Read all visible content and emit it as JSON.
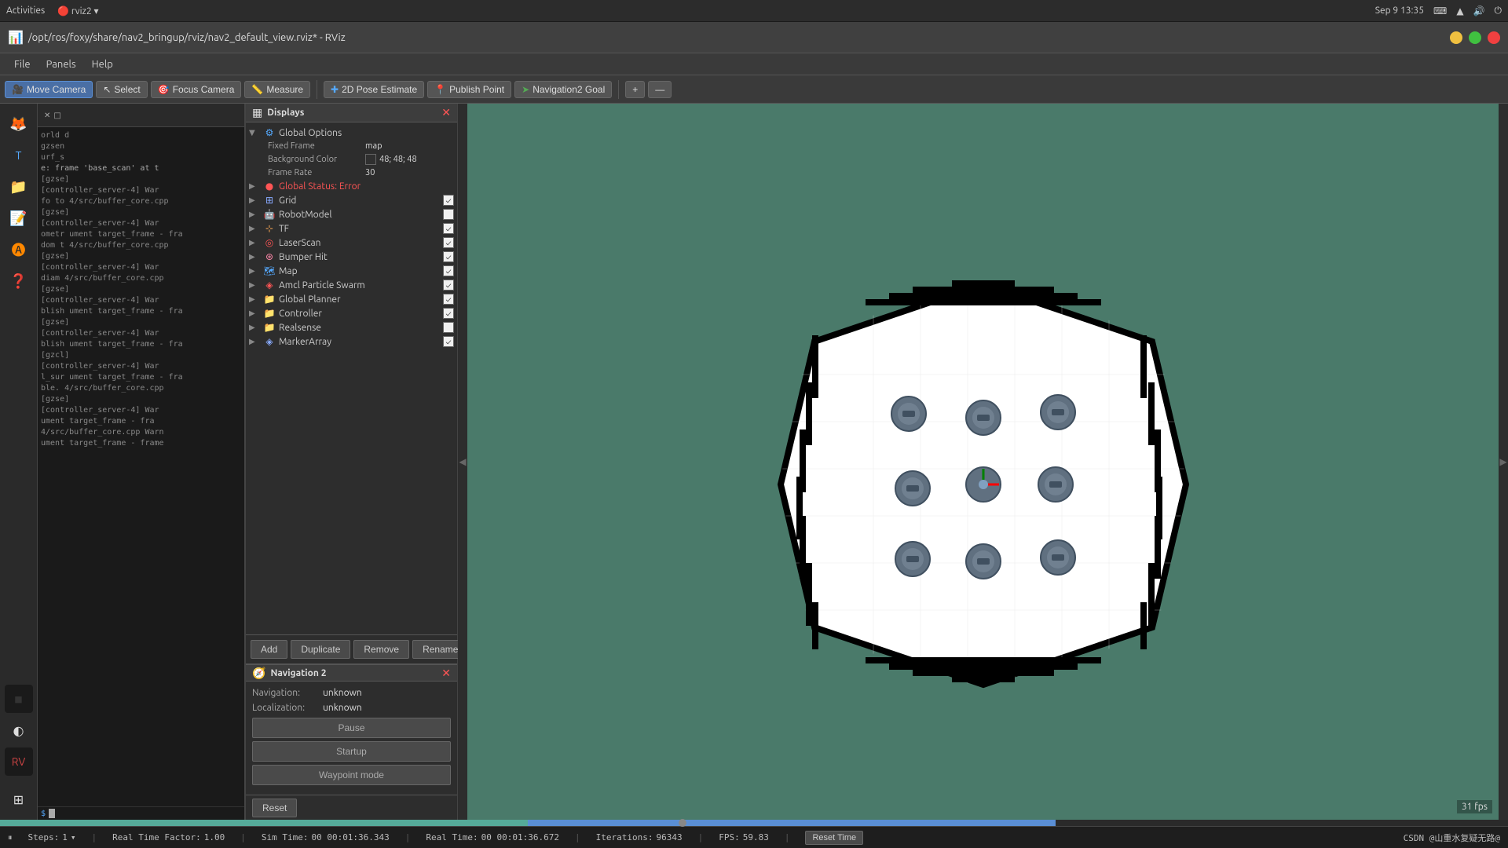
{
  "ubuntu": {
    "topbar": {
      "left_items": [
        "Activities"
      ],
      "app_name": "rviz2",
      "datetime": "Sep 9  13:35",
      "right_icons": [
        "keyboard",
        "wifi",
        "volume",
        "power"
      ]
    }
  },
  "window": {
    "title": "/opt/ros/foxy/share/nav2_bringup/rviz/nav2_default_view.rviz* - RViz",
    "close_btn": "✕",
    "max_btn": "□",
    "min_btn": "─"
  },
  "menu": {
    "items": [
      "File",
      "Panels",
      "Help"
    ]
  },
  "toolbar": {
    "move_camera_label": "Move Camera",
    "select_label": "Select",
    "focus_camera_label": "Focus Camera",
    "measure_label": "Measure",
    "pose_estimate_label": "2D Pose Estimate",
    "publish_point_label": "Publish Point",
    "nav2_goal_label": "Navigation2 Goal"
  },
  "displays": {
    "panel_title": "Displays",
    "global_options_label": "Global Options",
    "fixed_frame_key": "Fixed Frame",
    "fixed_frame_val": "map",
    "background_color_key": "Background Color",
    "background_color_val": "48; 48; 48",
    "frame_rate_key": "Frame Rate",
    "frame_rate_val": "30",
    "global_status_label": "Global Status: Error",
    "grid_label": "Grid",
    "robot_model_label": "RobotModel",
    "tf_label": "TF",
    "laser_scan_label": "LaserScan",
    "bumper_hit_label": "Bumper Hit",
    "map_label": "Map",
    "amcl_particle_label": "Amcl Particle Swarm",
    "global_planner_label": "Global Planner",
    "controller_label": "Controller",
    "realsense_label": "Realsense",
    "marker_array_label": "MarkerArray",
    "add_btn": "Add",
    "duplicate_btn": "Duplicate",
    "remove_btn": "Remove",
    "rename_btn": "Rename"
  },
  "nav2_panel": {
    "title": "Navigation 2",
    "navigation_key": "Navigation:",
    "navigation_val": "unknown",
    "localization_key": "Localization:",
    "localization_val": "unknown",
    "pause_btn": "Pause",
    "startup_btn": "Startup",
    "waypoint_btn": "Waypoint mode"
  },
  "bottom": {
    "reset_btn": "Reset",
    "fps": "31 fps"
  },
  "statusbar": {
    "pause_icon": "⏸",
    "steps_label": "Steps:",
    "steps_val": "1",
    "realtime_factor_label": "Real Time Factor:",
    "realtime_factor_val": "1.00",
    "sim_time_label": "Sim Time:",
    "sim_time_val": "00 00:01:36.343",
    "real_time_label": "Real Time:",
    "real_time_val": "00 00:01:36.672",
    "iterations_label": "Iterations:",
    "iterations_val": "96343",
    "fps_label": "FPS:",
    "fps_val": "59.83",
    "reset_time_btn": "Reset Time",
    "watermark": "CSDN @山重水复疑无路@"
  },
  "terminal": {
    "lines": [
      "orld d",
      "gzsen",
      "urf_s",
      "e: frame 'base_scan' at t",
      "[gzse]",
      "[controller_server-4] War",
      "fo to 4/src/buffer_core.cpp",
      "[gzse]",
      "[controller_server-4] War",
      "ometr ument target_frame - fra",
      "dom t 4/src/buffer_core.cpp",
      "[gzse]",
      "[controller_server-4] War",
      "diam  4/src/buffer_core.cpp",
      "[gzse]",
      "[controller_server-4] War",
      "blish ument target_frame - fra",
      "[gzse]",
      "[controller_server-4] War",
      "blish ument target_frame - fra",
      "[gzcl]",
      "[controller_server-4] War",
      "l_sur ument target_frame - fra",
      "ble.  4/src/buffer_core.cpp",
      "[gzse]",
      "[controller_server-4] War",
      "ument target_frame - fra",
      "4/src/buffer_core.cpp Warn",
      "ument target_frame - frame",
      "$"
    ]
  }
}
